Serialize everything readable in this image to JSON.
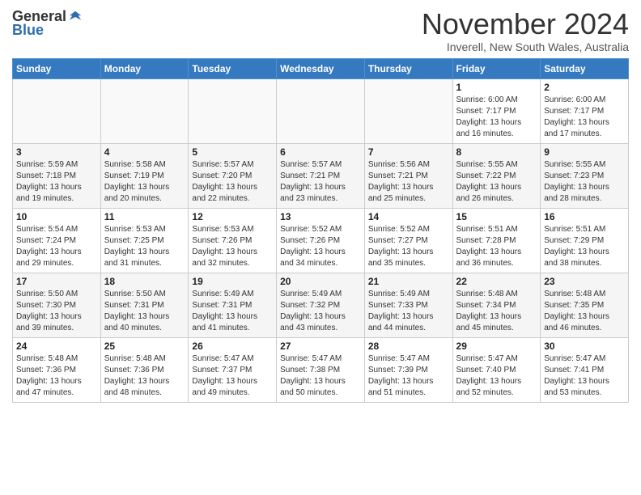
{
  "logo": {
    "general": "General",
    "blue": "Blue"
  },
  "title": "November 2024",
  "subtitle": "Inverell, New South Wales, Australia",
  "weekdays": [
    "Sunday",
    "Monday",
    "Tuesday",
    "Wednesday",
    "Thursday",
    "Friday",
    "Saturday"
  ],
  "weeks": [
    [
      {
        "day": "",
        "info": ""
      },
      {
        "day": "",
        "info": ""
      },
      {
        "day": "",
        "info": ""
      },
      {
        "day": "",
        "info": ""
      },
      {
        "day": "",
        "info": ""
      },
      {
        "day": "1",
        "info": "Sunrise: 6:00 AM\nSunset: 7:17 PM\nDaylight: 13 hours\nand 16 minutes."
      },
      {
        "day": "2",
        "info": "Sunrise: 6:00 AM\nSunset: 7:17 PM\nDaylight: 13 hours\nand 17 minutes."
      }
    ],
    [
      {
        "day": "3",
        "info": "Sunrise: 5:59 AM\nSunset: 7:18 PM\nDaylight: 13 hours\nand 19 minutes."
      },
      {
        "day": "4",
        "info": "Sunrise: 5:58 AM\nSunset: 7:19 PM\nDaylight: 13 hours\nand 20 minutes."
      },
      {
        "day": "5",
        "info": "Sunrise: 5:57 AM\nSunset: 7:20 PM\nDaylight: 13 hours\nand 22 minutes."
      },
      {
        "day": "6",
        "info": "Sunrise: 5:57 AM\nSunset: 7:21 PM\nDaylight: 13 hours\nand 23 minutes."
      },
      {
        "day": "7",
        "info": "Sunrise: 5:56 AM\nSunset: 7:21 PM\nDaylight: 13 hours\nand 25 minutes."
      },
      {
        "day": "8",
        "info": "Sunrise: 5:55 AM\nSunset: 7:22 PM\nDaylight: 13 hours\nand 26 minutes."
      },
      {
        "day": "9",
        "info": "Sunrise: 5:55 AM\nSunset: 7:23 PM\nDaylight: 13 hours\nand 28 minutes."
      }
    ],
    [
      {
        "day": "10",
        "info": "Sunrise: 5:54 AM\nSunset: 7:24 PM\nDaylight: 13 hours\nand 29 minutes."
      },
      {
        "day": "11",
        "info": "Sunrise: 5:53 AM\nSunset: 7:25 PM\nDaylight: 13 hours\nand 31 minutes."
      },
      {
        "day": "12",
        "info": "Sunrise: 5:53 AM\nSunset: 7:26 PM\nDaylight: 13 hours\nand 32 minutes."
      },
      {
        "day": "13",
        "info": "Sunrise: 5:52 AM\nSunset: 7:26 PM\nDaylight: 13 hours\nand 34 minutes."
      },
      {
        "day": "14",
        "info": "Sunrise: 5:52 AM\nSunset: 7:27 PM\nDaylight: 13 hours\nand 35 minutes."
      },
      {
        "day": "15",
        "info": "Sunrise: 5:51 AM\nSunset: 7:28 PM\nDaylight: 13 hours\nand 36 minutes."
      },
      {
        "day": "16",
        "info": "Sunrise: 5:51 AM\nSunset: 7:29 PM\nDaylight: 13 hours\nand 38 minutes."
      }
    ],
    [
      {
        "day": "17",
        "info": "Sunrise: 5:50 AM\nSunset: 7:30 PM\nDaylight: 13 hours\nand 39 minutes."
      },
      {
        "day": "18",
        "info": "Sunrise: 5:50 AM\nSunset: 7:31 PM\nDaylight: 13 hours\nand 40 minutes."
      },
      {
        "day": "19",
        "info": "Sunrise: 5:49 AM\nSunset: 7:31 PM\nDaylight: 13 hours\nand 41 minutes."
      },
      {
        "day": "20",
        "info": "Sunrise: 5:49 AM\nSunset: 7:32 PM\nDaylight: 13 hours\nand 43 minutes."
      },
      {
        "day": "21",
        "info": "Sunrise: 5:49 AM\nSunset: 7:33 PM\nDaylight: 13 hours\nand 44 minutes."
      },
      {
        "day": "22",
        "info": "Sunrise: 5:48 AM\nSunset: 7:34 PM\nDaylight: 13 hours\nand 45 minutes."
      },
      {
        "day": "23",
        "info": "Sunrise: 5:48 AM\nSunset: 7:35 PM\nDaylight: 13 hours\nand 46 minutes."
      }
    ],
    [
      {
        "day": "24",
        "info": "Sunrise: 5:48 AM\nSunset: 7:36 PM\nDaylight: 13 hours\nand 47 minutes."
      },
      {
        "day": "25",
        "info": "Sunrise: 5:48 AM\nSunset: 7:36 PM\nDaylight: 13 hours\nand 48 minutes."
      },
      {
        "day": "26",
        "info": "Sunrise: 5:47 AM\nSunset: 7:37 PM\nDaylight: 13 hours\nand 49 minutes."
      },
      {
        "day": "27",
        "info": "Sunrise: 5:47 AM\nSunset: 7:38 PM\nDaylight: 13 hours\nand 50 minutes."
      },
      {
        "day": "28",
        "info": "Sunrise: 5:47 AM\nSunset: 7:39 PM\nDaylight: 13 hours\nand 51 minutes."
      },
      {
        "day": "29",
        "info": "Sunrise: 5:47 AM\nSunset: 7:40 PM\nDaylight: 13 hours\nand 52 minutes."
      },
      {
        "day": "30",
        "info": "Sunrise: 5:47 AM\nSunset: 7:41 PM\nDaylight: 13 hours\nand 53 minutes."
      }
    ]
  ]
}
